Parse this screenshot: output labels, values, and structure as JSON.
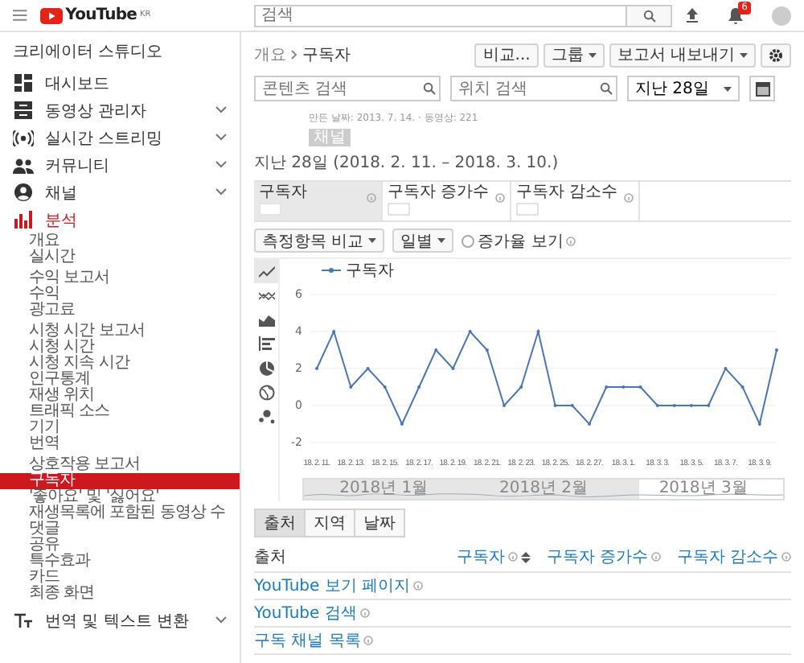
{
  "header": {
    "logo": "YouTube",
    "region": "KR",
    "search": {
      "placeholder": "검색"
    },
    "notifications": "6"
  },
  "sidebar": {
    "title": "크리에이터 스튜디오",
    "items": [
      {
        "label": "대시보드",
        "kind": "dashboard",
        "expandable": false,
        "selected": false
      },
      {
        "label": "동영상 관리자",
        "kind": "videos",
        "expandable": true,
        "selected": false
      },
      {
        "label": "실시간 스트리밍",
        "kind": "live",
        "expandable": true,
        "selected": false
      },
      {
        "label": "커뮤니티",
        "kind": "community",
        "expandable": true,
        "selected": false
      },
      {
        "label": "채널",
        "kind": "channel",
        "expandable": true,
        "selected": false
      },
      {
        "label": "분석",
        "kind": "analytics",
        "expandable": false,
        "selected": true
      }
    ],
    "groups": [
      {
        "items": [
          {
            "label": "개요",
            "selected": false
          },
          {
            "label": "실시간",
            "selected": false
          }
        ]
      },
      {
        "items": [
          {
            "label": "수익 보고서",
            "selected": false
          },
          {
            "label": "수익",
            "selected": false
          },
          {
            "label": "광고료",
            "selected": false
          }
        ]
      },
      {
        "items": [
          {
            "label": "시청 시간 보고서",
            "selected": false
          },
          {
            "label": "시청 시간",
            "selected": false
          },
          {
            "label": "시청 지속 시간",
            "selected": false
          },
          {
            "label": "인구통계",
            "selected": false
          },
          {
            "label": "재생 위치",
            "selected": false
          },
          {
            "label": "트래픽 소스",
            "selected": false
          },
          {
            "label": "기기",
            "selected": false
          },
          {
            "label": "번역",
            "selected": false
          }
        ]
      },
      {
        "items": [
          {
            "label": "상호작용 보고서",
            "selected": false
          },
          {
            "label": "구독자",
            "selected": true
          },
          {
            "label": "'좋아요' 및 '싫어요'",
            "selected": false
          },
          {
            "label": "재생목록에 포함된 동영상 수",
            "selected": false
          },
          {
            "label": "댓글",
            "selected": false
          },
          {
            "label": "공유",
            "selected": false
          },
          {
            "label": "특수효과",
            "selected": false
          },
          {
            "label": "카드",
            "selected": false
          },
          {
            "label": "최종 화면",
            "selected": false
          }
        ]
      }
    ],
    "footer_item": {
      "label": "번역 및 텍스트 변환",
      "expandable": true
    }
  },
  "breadcrumb": {
    "parent": "개요",
    "current": "구독자"
  },
  "toolbar": [
    {
      "label": "비교...",
      "dropdown": false
    },
    {
      "label": "그룹",
      "dropdown": true
    },
    {
      "label": "보고서 내보내기",
      "dropdown": true
    }
  ],
  "filters": {
    "content_search": {
      "placeholder": "콘텐츠 검색"
    },
    "location_search": {
      "placeholder": "위치 검색"
    },
    "date_range": "지난 28일"
  },
  "channel": {
    "meta": "만든 날짜: 2013. 7. 14. · 동영상: 221",
    "tag": "채널"
  },
  "period_title": "지난 28일 (2018. 2. 11. – 2018. 3. 10.)",
  "metrics": [
    {
      "label": "구독자",
      "selected": true
    },
    {
      "label": "구독자 증가수",
      "selected": false
    },
    {
      "label": "구독자 감소수",
      "selected": false
    }
  ],
  "chart_controls": {
    "compare": "측정항목 비교",
    "interval": "일별",
    "growth": {
      "label": "증가율 보기",
      "checked": false
    }
  },
  "chart_views": [
    {
      "kind": "line",
      "selected": true
    },
    {
      "kind": "multiline",
      "selected": false
    },
    {
      "kind": "area",
      "selected": false
    },
    {
      "kind": "bar",
      "selected": false
    },
    {
      "kind": "pie",
      "selected": false
    },
    {
      "kind": "map",
      "selected": false
    },
    {
      "kind": "bubble",
      "selected": false
    }
  ],
  "chart": {
    "chart_data": {
      "type": "line",
      "grid": true,
      "categories": [
        "18. 2. 11.",
        null,
        "18. 2. 13.",
        null,
        "18. 2. 15.",
        null,
        "18. 2. 17.",
        null,
        "18. 2. 19.",
        null,
        "18. 2. 21.",
        null,
        "18. 2. 23.",
        null,
        "18. 2. 25.",
        null,
        "18. 2. 27.",
        null,
        "18. 3. 1.",
        null,
        "18. 3. 3.",
        null,
        "18. 3. 5.",
        null,
        "18. 3. 7.",
        null,
        "18. 3. 9.",
        null
      ],
      "series": [
        {
          "name": "구독자",
          "color": "#4a76b8",
          "values": [
            2,
            4,
            1,
            2,
            1,
            -1,
            1,
            3,
            2,
            4,
            3,
            0,
            1,
            4,
            0,
            0,
            -1,
            1,
            1,
            1,
            0,
            0,
            0,
            0,
            2,
            1,
            -1,
            3
          ]
        }
      ],
      "ylim": [
        -2,
        6
      ],
      "yticks": [
        -2,
        0,
        2,
        4,
        6
      ]
    },
    "navigator": {
      "labels": [
        "2018년 1월",
        "2018년 2월",
        "2018년 3월"
      ]
    }
  },
  "detail_tabs": [
    {
      "label": "출처",
      "selected": true
    },
    {
      "label": "지역",
      "selected": false
    },
    {
      "label": "날짜",
      "selected": false
    }
  ],
  "table": {
    "columns": [
      {
        "label": "출처",
        "sorted": false
      },
      {
        "label": "구독자",
        "sorted": true
      },
      {
        "label": "구독자 증가수",
        "sorted": false
      },
      {
        "label": "구독자 감소수",
        "sorted": false
      }
    ],
    "rows": [
      {
        "source": "YouTube 보기 페이지"
      },
      {
        "source": "YouTube 검색"
      },
      {
        "source": "구독 채널 목록"
      }
    ]
  }
}
